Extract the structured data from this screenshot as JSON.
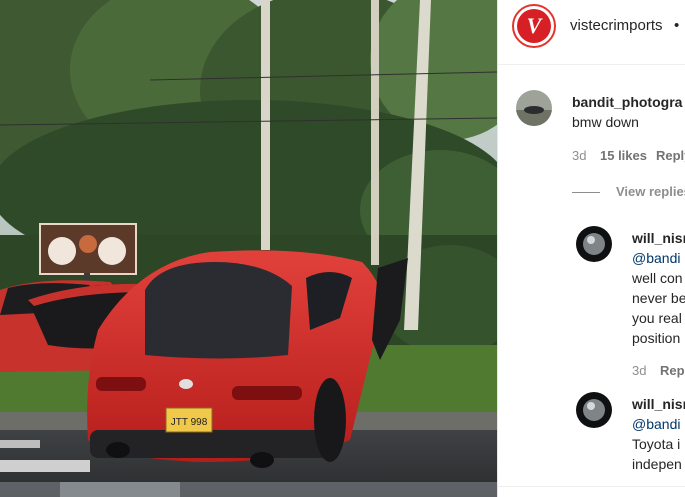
{
  "post": {
    "author": "vistecrimports",
    "separator": "•",
    "license_plate": "JTT 998"
  },
  "comments": [
    {
      "user": "bandit_photogra",
      "text": "bmw down",
      "age": "3d",
      "likes": "15 likes",
      "reply": "Reply",
      "view_replies": "View replies"
    }
  ],
  "replies": [
    {
      "user": "will_nism",
      "lines": [
        "@bandi",
        "well con",
        "never be",
        "you real",
        "position"
      ],
      "age": "3d",
      "reply": "Repl"
    },
    {
      "user": "will_nism",
      "lines": [
        "@bandi",
        "Toyota i",
        "indepen"
      ]
    }
  ],
  "colors": {
    "car": "#d12a26",
    "brand": "#d71f26",
    "mention": "#00376b"
  }
}
